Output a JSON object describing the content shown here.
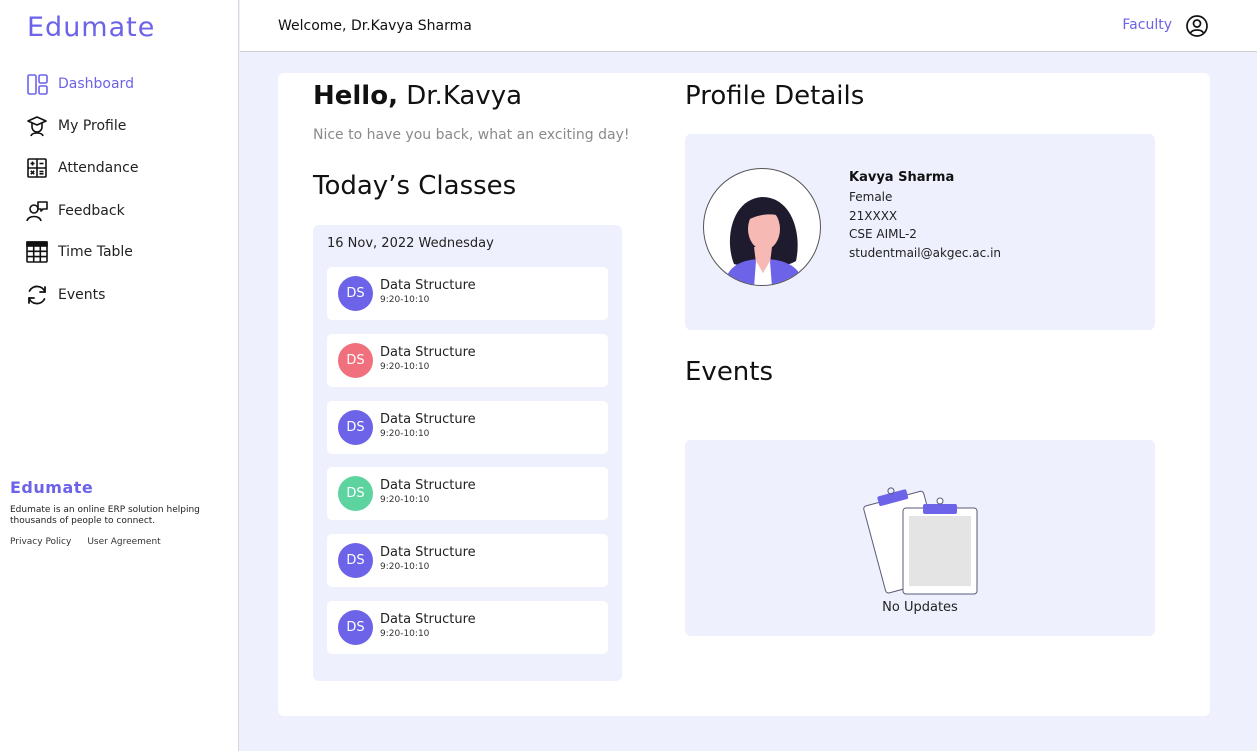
{
  "sidebar": {
    "brand": "Edumate",
    "items": [
      {
        "label": "Dashboard",
        "icon": "dashboard-icon"
      },
      {
        "label": "My Profile",
        "icon": "graduate-icon"
      },
      {
        "label": "Attendance",
        "icon": "calculator-icon"
      },
      {
        "label": "Feedback",
        "icon": "feedback-icon"
      },
      {
        "label": "Time Table",
        "icon": "table-icon"
      },
      {
        "label": "Events",
        "icon": "refresh-icon"
      }
    ],
    "footer": {
      "brand": "Edumate",
      "description": "Edumate is an online ERP solution helping thousands of people to connect.",
      "links": [
        "Privacy Policy",
        "User Agreement"
      ]
    }
  },
  "header": {
    "welcome": "Welcome, Dr.Kavya Sharma",
    "role": "Faculty",
    "user_icon": "user-circle-icon"
  },
  "greeting": {
    "hello": "Hello,",
    "name": "Dr.Kavya",
    "subtitle": "Nice to have you back, what an exciting day!"
  },
  "classes": {
    "title": "Today’s Classes",
    "date": "16 Nov, 2022 Wednesday",
    "items": [
      {
        "initials": "DS",
        "name": "Data Structure",
        "time": "9:20-10:10",
        "color": "#6C63E8"
      },
      {
        "initials": "DS",
        "name": "Data Structure",
        "time": "9:20-10:10",
        "color": "#F0707E"
      },
      {
        "initials": "DS",
        "name": "Data Structure",
        "time": "9:20-10:10",
        "color": "#6C63E8"
      },
      {
        "initials": "DS",
        "name": "Data Structure",
        "time": "9:20-10:10",
        "color": "#5DD3A0"
      },
      {
        "initials": "DS",
        "name": "Data Structure",
        "time": "9:20-10:10",
        "color": "#6C63E8"
      },
      {
        "initials": "DS",
        "name": "Data Structure",
        "time": "9:20-10:10",
        "color": "#6C63E8"
      }
    ]
  },
  "profile": {
    "title": "Profile Details",
    "name": "Kavya Sharma",
    "gender": "Female",
    "id": "21XXXX",
    "section": "CSE AIML-2",
    "email": "studentmail@akgec.ac.in"
  },
  "events": {
    "title": "Events",
    "empty_text": "No Updates"
  },
  "colors": {
    "accent": "#6C63E8",
    "background": "#EEF0FD"
  }
}
